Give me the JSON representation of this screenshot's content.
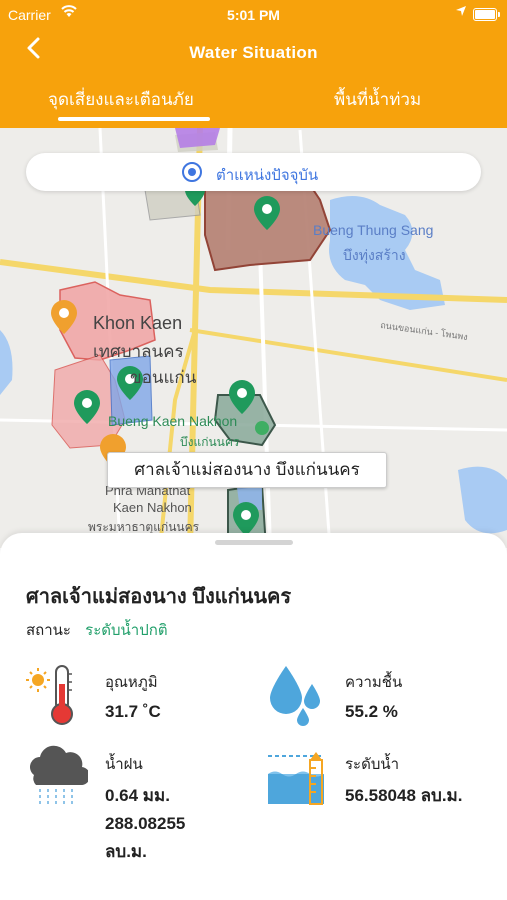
{
  "status_bar": {
    "carrier": "Carrier",
    "time": "5:01 PM"
  },
  "header": {
    "title": "Water Situation",
    "tabs": [
      {
        "label": "จุดเสี่ยงและเตือนภัย",
        "active": true
      },
      {
        "label": "พื้นที่น้ำท่วม",
        "active": false
      }
    ]
  },
  "map": {
    "location_button": "ตำแหน่งปัจจุบัน",
    "labels": {
      "bueng_thung_sang_en": "Bueng Thung Sang",
      "bueng_thung_sang_th": "บึงทุ่งสร้าง",
      "khon_kaen_en": "Khon Kaen",
      "khon_kaen_th1": "เทศบาลนคร",
      "khon_kaen_th2": "ขอนแก่น",
      "bueng_kaen_nakhon_en": "Bueng Kaen Nakhon",
      "bueng_kaen_nakhon_th": "บึงแก่นนคร",
      "phra_mahathat_en1": "Phra Mahathat",
      "phra_mahathat_en2": "Kaen Nakhon",
      "phra_mahathat_th": "พระมหาธาตุแก่นนคร",
      "road": "ถนนขอนแก่น - โพนพง"
    },
    "callout": "ศาลเจ้าแม่สองนาง บึงแก่นนคร"
  },
  "detail": {
    "place_name": "ศาลเจ้าแม่สองนาง บึงแก่นนคร",
    "status_label": "สถานะ",
    "status_value": "ระดับน้ำปกติ",
    "temperature": {
      "label": "อุณหภูมิ",
      "value": "31.7 ˚C",
      "icon": "thermometer-sun-icon"
    },
    "humidity": {
      "label": "ความชื้น",
      "value": "55.2 %",
      "icon": "water-drops-icon"
    },
    "rain": {
      "label": "น้ำฝน",
      "value_lines": [
        "0.64 มม.",
        "288.08255",
        "ลบ.ม."
      ],
      "icon": "rain-cloud-icon"
    },
    "water_level": {
      "label": "ระดับน้ำ",
      "value": "56.58048 ลบ.ม.",
      "icon": "water-level-icon"
    }
  },
  "colors": {
    "header": "#F7A20C",
    "status_ok": "#22A06B",
    "accent": "#3F76E0",
    "pin": "#1F9A5C"
  }
}
